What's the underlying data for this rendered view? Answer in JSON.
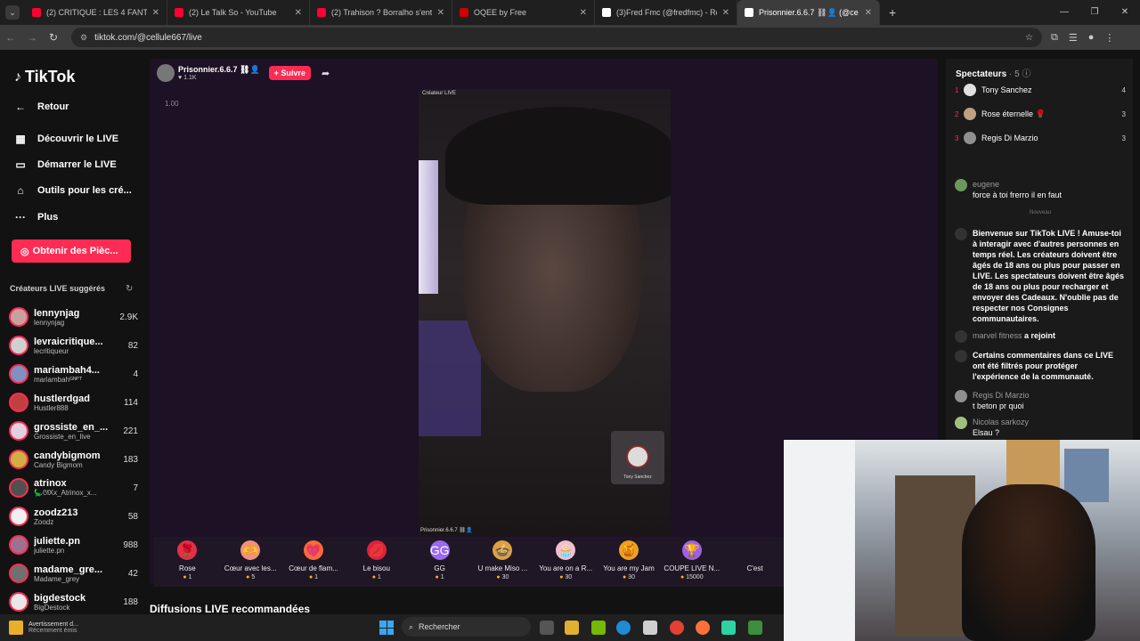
{
  "browser": {
    "tabs": [
      {
        "title": "(2) CRITIQUE : LES 4 FANTASTIQU",
        "favicon_color": "#ff0033"
      },
      {
        "title": "(2) Le Talk So - YouTube",
        "favicon_color": "#ff0033"
      },
      {
        "title": "(2) Trahison ? Borralho s'entraîn",
        "favicon_color": "#ff0033"
      },
      {
        "title": "OQEE by Free",
        "favicon_color": "#cc0000"
      },
      {
        "title": "(3)Fred Fmc (@fredfmc) - Rega",
        "favicon_color": "#ffffff"
      },
      {
        "title": "Prisonnier.6.6.7 ⛓👤 (@ce",
        "favicon_color": "#ffffff"
      }
    ],
    "url": "tiktok.com/@cellule667/live"
  },
  "sidebar": {
    "logo": "TikTok",
    "back": "Retour",
    "nav": [
      {
        "label": "Découvrir le LIVE",
        "icon": "calendar-icon"
      },
      {
        "label": "Démarrer le LIVE",
        "icon": "camera-icon"
      },
      {
        "label": "Outils pour les cré...",
        "icon": "home-tools-icon"
      },
      {
        "label": "Plus",
        "icon": "more-icon"
      }
    ],
    "coins_button": "Obtenir des Pièc...",
    "suggested_title": "Créateurs LIVE suggérés",
    "creators": [
      {
        "name": "lennynjag",
        "handle": "lennynjag",
        "count": "2.9K",
        "color": "#c8a0a0"
      },
      {
        "name": "levraicritique...",
        "handle": "lecritiqueur",
        "count": "82",
        "color": "#d0d0d0"
      },
      {
        "name": "mariambah4...",
        "handle": "mariambahᴳᴺᴾᵀ",
        "count": "4",
        "color": "#8090c0"
      },
      {
        "name": "hustlerdgad",
        "handle": "Hustler888",
        "count": "114",
        "color": "#c04040"
      },
      {
        "name": "grossiste_en_...",
        "handle": "Grossiste_en_live",
        "count": "221",
        "color": "#e0d0e0"
      },
      {
        "name": "candybigmom",
        "handle": "Candy Bigmom",
        "count": "183",
        "color": "#d0b040"
      },
      {
        "name": "atrinox",
        "handle": "🦕ᘛXx_Atrinox_x...",
        "count": "7",
        "color": "#505050"
      },
      {
        "name": "zoodz213",
        "handle": "Zoodz",
        "count": "58",
        "color": "#f0f0f0"
      },
      {
        "name": "juliette.pn",
        "handle": "juliette.pn",
        "count": "988",
        "color": "#a07090"
      },
      {
        "name": "madame_gre...",
        "handle": "Madame_grey",
        "count": "42",
        "color": "#707070"
      },
      {
        "name": "bigdestock",
        "handle": "BigDestock",
        "count": "188",
        "color": "#e8e8e8"
      }
    ]
  },
  "stream": {
    "host_name": "Prisonnier.6.6.7 ⛓👤",
    "likes": "♥ 1.1K",
    "follow_label": "+ Suivre",
    "zoom": "1.00",
    "video_title": "Créateur LIVE",
    "video_footer": "Prisonnier.6.6.7 ⛓👤",
    "guest_name": "Tony Sanchez"
  },
  "gifts": [
    {
      "name": "Rose",
      "price": "1",
      "glyph": "🌹",
      "color": "#e0304a"
    },
    {
      "name": "Cœur avec les...",
      "price": "5",
      "glyph": "🫶",
      "color": "#f09080"
    },
    {
      "name": "Cœur de flam...",
      "price": "1",
      "glyph": "💗",
      "color": "#ff6a3a"
    },
    {
      "name": "Le bisou",
      "price": "1",
      "glyph": "💋",
      "color": "#e02040"
    },
    {
      "name": "GG",
      "price": "1",
      "glyph": "GG",
      "color": "#9a6af0"
    },
    {
      "name": "U make Miso ...",
      "price": "30",
      "glyph": "🍲",
      "color": "#e0a040"
    },
    {
      "name": "You are on a R...",
      "price": "30",
      "glyph": "🧁",
      "color": "#f0c0d0"
    },
    {
      "name": "You are my Jam",
      "price": "30",
      "glyph": "🍯",
      "color": "#f0a020"
    },
    {
      "name": "COUPE LIVE N...",
      "price": "15000",
      "glyph": "🏆",
      "color": "#a060e0"
    },
    {
      "name": "C'est",
      "price": "",
      "glyph": "",
      "color": "#201726"
    }
  ],
  "recommend_title": "Diffusions LIVE recommandées",
  "spectators": {
    "title": "Spectateurs",
    "count": "· 5",
    "list": [
      {
        "rank": "1",
        "name": "Tony Sanchez",
        "score": "4",
        "color": "#e0e0e0"
      },
      {
        "rank": "2",
        "name": "Rose éternelle 🌹",
        "score": "3",
        "color": "#c0a080"
      },
      {
        "rank": "3",
        "name": "Regis Di Marzio",
        "score": "3",
        "color": "#909090"
      }
    ]
  },
  "chat": {
    "messages": [
      {
        "user": "eugene",
        "text": "force à toi frerro il en faut",
        "color": "#6a9a5a"
      },
      {
        "user": "",
        "text": "Bienvenue sur TikTok LIVE ! Amuse-toi à interagir avec d'autres personnes en temps réel. Les créateurs doivent être âgés de 18 ans ou plus pour passer en LIVE. Les spectateurs doivent être âgés de 18 ans ou plus pour recharger et envoyer des Cadeaux. N'oublie pas de respecter nos Consignes communautaires.",
        "color": "#333333"
      },
      {
        "user": "marvel fitness",
        "text": "a rejoint",
        "color": "#333333"
      },
      {
        "user": "",
        "text": "Certains commentaires dans ce LIVE ont été filtrés pour protéger l'expérience de la communauté.",
        "color": "#333333"
      },
      {
        "user": "Regis Di Marzio",
        "text": "t beton pr quoi",
        "color": "#909090"
      },
      {
        "user": "Nicolas sarkozy",
        "text": "Elsau ?",
        "color": "#a0c080"
      }
    ],
    "new_divider": "Nouveau"
  },
  "taskbar": {
    "notif_title": "Avertissement d...",
    "notif_sub": "Récemment émis",
    "search": "Rechercher"
  }
}
